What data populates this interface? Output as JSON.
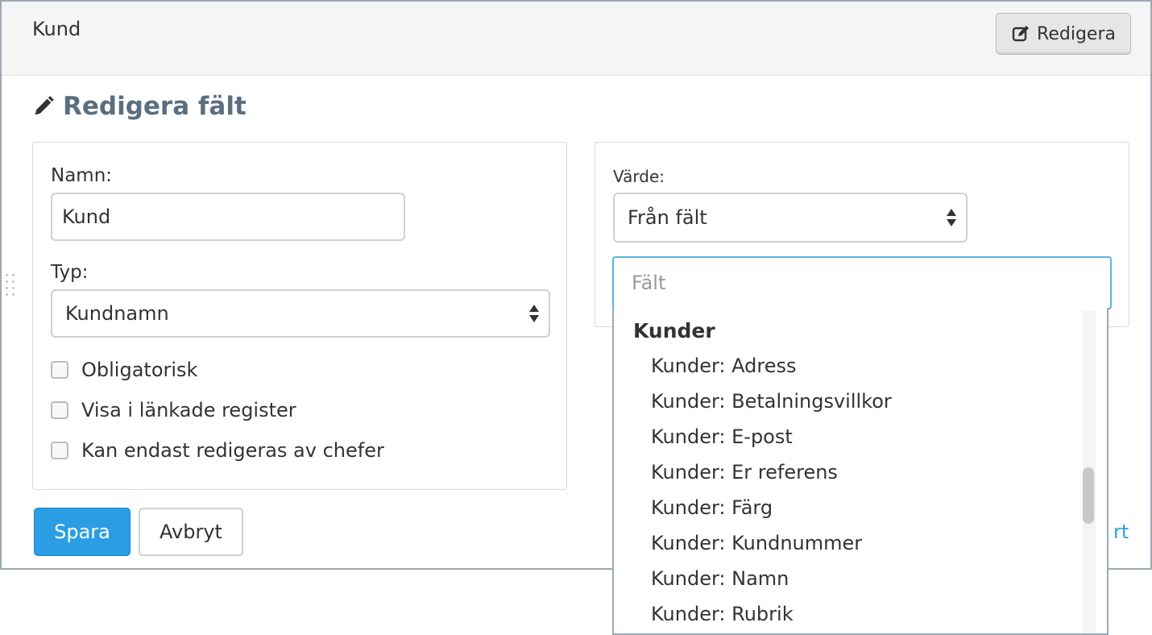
{
  "header": {
    "title": "Kund",
    "edit_button": "Redigera"
  },
  "form": {
    "heading": "Redigera fält",
    "name_label": "Namn:",
    "name_value": "Kund",
    "type_label": "Typ:",
    "type_value": "Kundnamn",
    "checkboxes": [
      {
        "label": "Obligatorisk",
        "checked": false
      },
      {
        "label": "Visa i länkade register",
        "checked": false
      },
      {
        "label": "Kan endast redigeras av chefer",
        "checked": false
      }
    ],
    "value_label": "Värde:",
    "value_select": "Från fält",
    "field_placeholder": "Fält"
  },
  "actions": {
    "save": "Spara",
    "cancel": "Avbryt",
    "partial_link": "rt"
  },
  "dropdown": {
    "group": "Kunder",
    "items": [
      "Kunder: Adress",
      "Kunder: Betalningsvillkor",
      "Kunder: E-post",
      "Kunder: Er referens",
      "Kunder: Färg",
      "Kunder: Kundnummer",
      "Kunder: Namn",
      "Kunder: Rubrik"
    ]
  },
  "colors": {
    "primary": "#2b9ee3",
    "heading": "#5a6e7f",
    "focus_border": "#5bb3e8"
  },
  "icons": {
    "edit_button_icon": "edit-square-icon",
    "heading_icon": "pencil-icon",
    "select_icon": "sort-arrows-icon"
  }
}
